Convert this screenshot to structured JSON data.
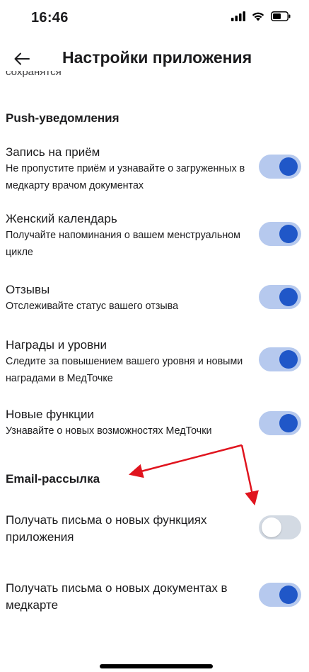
{
  "status_bar": {
    "time": "16:46"
  },
  "header": {
    "title": "Настройки приложения"
  },
  "scrolled_text": "сохранятся",
  "push_section": {
    "title": "Push-уведомления",
    "items": [
      {
        "title": "Запись на приём",
        "subtitle": "Не пропустите приём и узнавайте  о загруженных в медкарту врачом документах",
        "enabled": true
      },
      {
        "title": "Женский календарь",
        "subtitle": "Получайте напоминания о вашем менструальном цикле",
        "enabled": true
      },
      {
        "title": "Отзывы",
        "subtitle": "Отслеживайте статус вашего отзыва",
        "enabled": true
      },
      {
        "title": "Награды и уровни",
        "subtitle": "Следите за повышением вашего уровня  и новыми наградами в МедТочке",
        "enabled": true
      },
      {
        "title": "Новые функции",
        "subtitle": "Узнавайте о новых возможностях МедТочки",
        "enabled": true
      }
    ]
  },
  "email_section": {
    "title": "Email-рассылка",
    "items": [
      {
        "title": "Получать письма о новых функциях приложения",
        "enabled": false
      },
      {
        "title": "Получать письма о новых документах в медкарте",
        "enabled": true
      }
    ]
  },
  "colors": {
    "toggle_on_track": "#b6c9ee",
    "toggle_on_knob": "#2057c8",
    "toggle_off_track": "#d3dae3",
    "annotation_arrow": "#e0141e"
  }
}
